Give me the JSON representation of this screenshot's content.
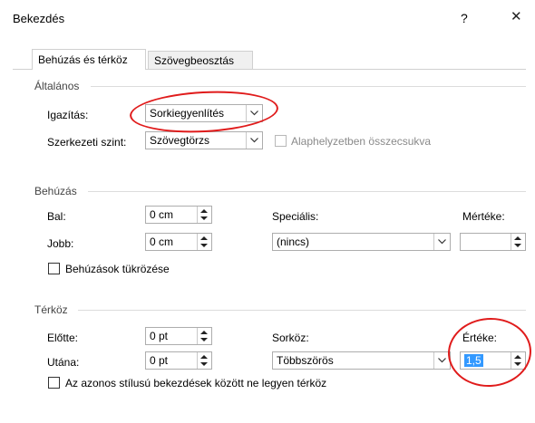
{
  "window": {
    "title": "Bekezdés",
    "help_glyph": "?",
    "close_glyph": "✕"
  },
  "tabs": [
    {
      "label": "Behúzás és térköz",
      "active": true
    },
    {
      "label": "Szövegbeosztás",
      "active": false
    }
  ],
  "general": {
    "header": "Általános",
    "alignment_label": "Igazítás:",
    "alignment_value": "Sorkiegyenlítés",
    "outline_label": "Szerkezeti szint:",
    "outline_value": "Szövegtörzs",
    "collapsed_label": "Alaphelyzetben összecsukva"
  },
  "indentation": {
    "header": "Behúzás",
    "left_label": "Bal:",
    "left_value": "0 cm",
    "right_label": "Jobb:",
    "right_value": "0 cm",
    "special_label": "Speciális:",
    "special_value": "(nincs)",
    "by_label": "Mértéke:",
    "by_value": "",
    "mirror_label": "Behúzások tükrözése"
  },
  "spacing": {
    "header": "Térköz",
    "before_label": "Előtte:",
    "before_value": "0 pt",
    "after_label": "Utána:",
    "after_value": "0 pt",
    "line_label": "Sorköz:",
    "line_value": "Többszörös",
    "at_label": "Értéke:",
    "at_value": "1,5",
    "nospace_label": "Az azonos stílusú bekezdések között ne legyen térköz"
  },
  "colors": {
    "annotation_red": "#e01b1b",
    "selection_blue": "#3399ff"
  }
}
